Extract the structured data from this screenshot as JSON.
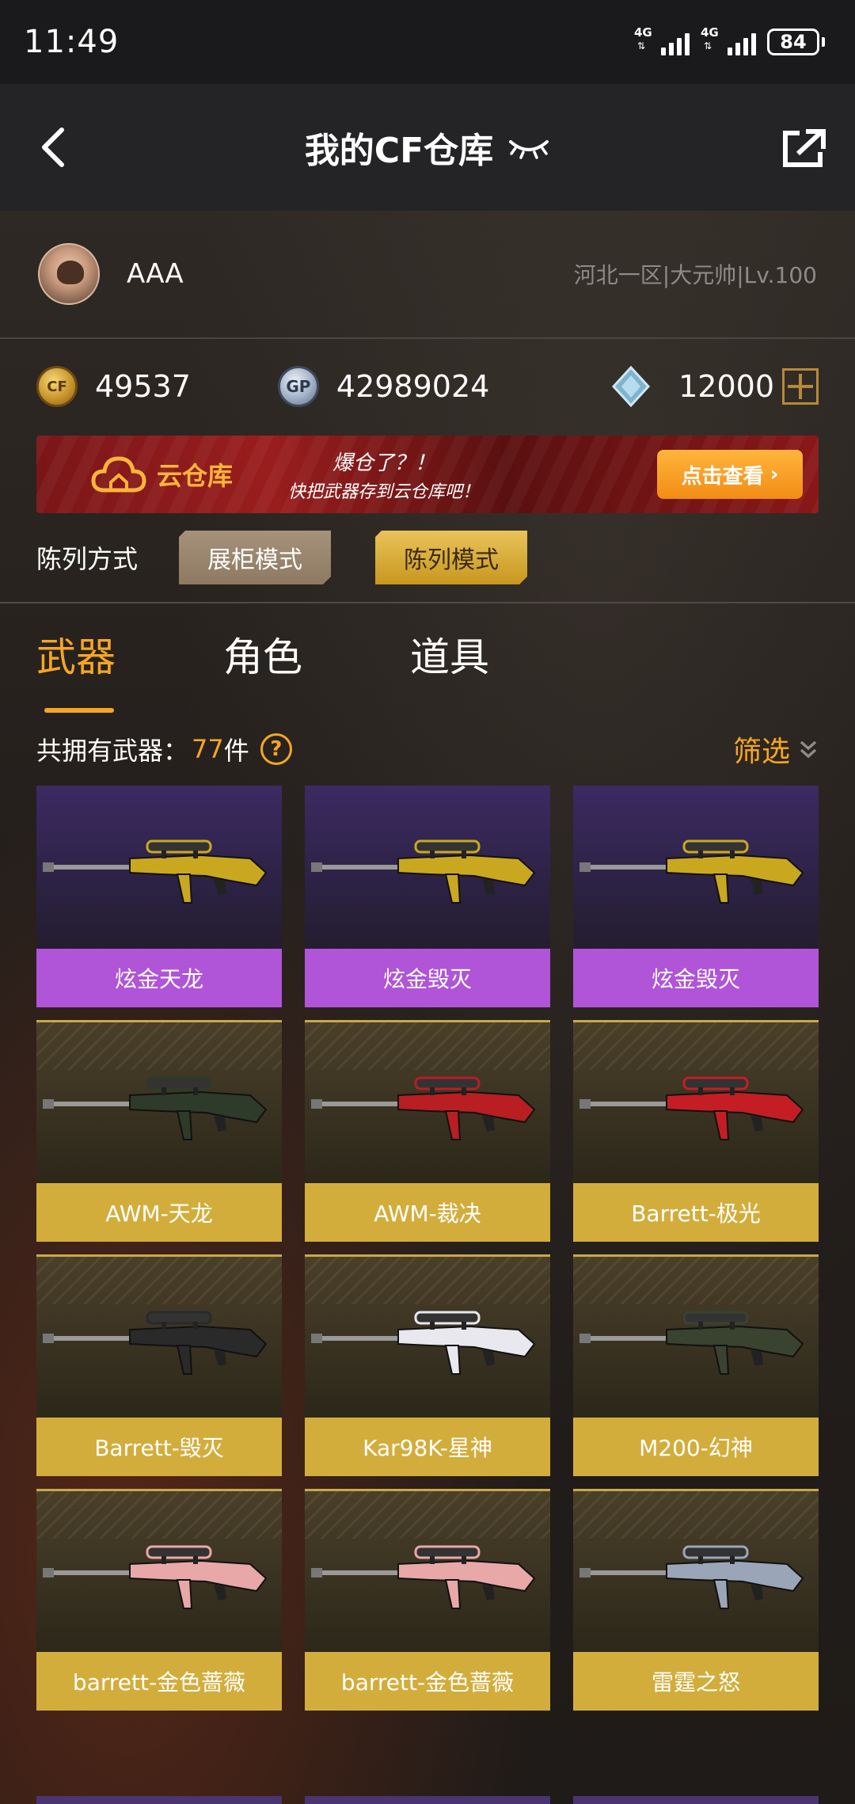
{
  "status_bar": {
    "time": "11:49",
    "network1": "4G",
    "network2": "4G",
    "battery": "84"
  },
  "header": {
    "title": "我的CF仓库"
  },
  "user": {
    "name": "AAA",
    "region": "河北一区|大元帅|Lv.100"
  },
  "currency": {
    "cf_points": "49537",
    "gp_label": "GP",
    "gp": "42989024",
    "diamonds": "12000"
  },
  "banner": {
    "title": "云仓库",
    "line1": "爆仓了？！",
    "line2": "快把武器存到云仓库吧！",
    "button": "点击查看"
  },
  "display_mode": {
    "label": "陈列方式",
    "cabinet": "展柜模式",
    "list": "陈列模式"
  },
  "tabs": [
    {
      "label": "武器",
      "active": true
    },
    {
      "label": "角色",
      "active": false
    },
    {
      "label": "道具",
      "active": false
    }
  ],
  "inventory": {
    "count_label": "共拥有武器：",
    "count": "77",
    "unit": "件",
    "filter": "筛选"
  },
  "weapons": [
    {
      "name": "炫金天龙",
      "rarity": "purple",
      "color": "#c9a820"
    },
    {
      "name": "炫金毁灭",
      "rarity": "purple",
      "color": "#c9a820"
    },
    {
      "name": "炫金毁灭",
      "rarity": "purple",
      "color": "#c9a820"
    },
    {
      "name": "AWM-天龙",
      "rarity": "gold",
      "color": "#2e3a2a"
    },
    {
      "name": "AWM-裁决",
      "rarity": "gold",
      "color": "#b81e22"
    },
    {
      "name": "Barrett-极光",
      "rarity": "gold",
      "color": "#c41e24"
    },
    {
      "name": "Barrett-毁灭",
      "rarity": "gold",
      "color": "#2a2a2a"
    },
    {
      "name": "Kar98K-星神",
      "rarity": "gold",
      "color": "#e8e8ee"
    },
    {
      "name": "M200-幻神",
      "rarity": "gold",
      "color": "#3a4230"
    },
    {
      "name": "barrett-金色蔷薇",
      "rarity": "gold",
      "color": "#e8a8a8"
    },
    {
      "name": "barrett-金色蔷薇",
      "rarity": "gold",
      "color": "#e8a8a8"
    },
    {
      "name": "雷霆之怒",
      "rarity": "gold",
      "color": "#9aa6b8"
    }
  ],
  "colors": {
    "accent": "#f6a623",
    "purple_label": "#b054d8",
    "gold_label": "#d3ad3c"
  }
}
